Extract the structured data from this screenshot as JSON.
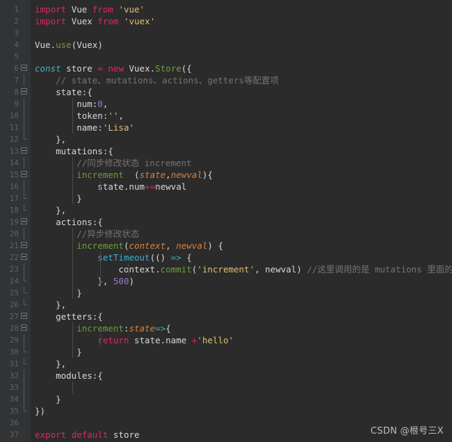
{
  "editor": {
    "theme": "darcula",
    "background": "#2b2b2b",
    "gutter_background": "#313335",
    "line_number_color": "#606366",
    "default_text_color": "#a9b7c6",
    "colors": {
      "keyword": "#e2265f",
      "string": "#e5bf6e",
      "number": "#9876dd",
      "comment": "#737570",
      "function": "#6a9f3e",
      "builtin": "#3eb0c7",
      "parameter": "#d9803d",
      "operator": "#e2265f",
      "plain": "#d8d8d8"
    },
    "total_lines": 37,
    "language": "javascript",
    "filename_hint": "store.js"
  },
  "watermark": {
    "text": "CSDN @根号三X"
  },
  "lines": [
    {
      "n": 1,
      "fold": "none",
      "guides": [],
      "tokens": [
        {
          "t": "import",
          "c": "imp"
        },
        {
          "t": " ",
          "c": "plain"
        },
        {
          "t": "Vue",
          "c": "plain"
        },
        {
          "t": " ",
          "c": "plain"
        },
        {
          "t": "from",
          "c": "imp"
        },
        {
          "t": " ",
          "c": "plain"
        },
        {
          "t": "'vue'",
          "c": "str"
        }
      ]
    },
    {
      "n": 2,
      "fold": "none",
      "guides": [],
      "tokens": [
        {
          "t": "import",
          "c": "imp"
        },
        {
          "t": " ",
          "c": "plain"
        },
        {
          "t": "Vuex",
          "c": "plain"
        },
        {
          "t": " ",
          "c": "plain"
        },
        {
          "t": "from",
          "c": "imp"
        },
        {
          "t": " ",
          "c": "plain"
        },
        {
          "t": "'vuex'",
          "c": "str"
        }
      ]
    },
    {
      "n": 3,
      "fold": "none",
      "guides": [],
      "tokens": []
    },
    {
      "n": 4,
      "fold": "none",
      "guides": [],
      "tokens": [
        {
          "t": "Vue",
          "c": "plain"
        },
        {
          "t": ".",
          "c": "plain"
        },
        {
          "t": "use",
          "c": "fn"
        },
        {
          "t": "(Vuex)",
          "c": "plain"
        }
      ]
    },
    {
      "n": 5,
      "fold": "none",
      "guides": [],
      "tokens": []
    },
    {
      "n": 6,
      "fold": "box",
      "guides": [],
      "tokens": [
        {
          "t": "const",
          "c": "italic"
        },
        {
          "t": " store ",
          "c": "plain"
        },
        {
          "t": "=",
          "c": "op"
        },
        {
          "t": " ",
          "c": "plain"
        },
        {
          "t": "new",
          "c": "imp"
        },
        {
          "t": " Vuex.",
          "c": "plain"
        },
        {
          "t": "Store",
          "c": "fn"
        },
        {
          "t": "({",
          "c": "plain"
        }
      ]
    },
    {
      "n": 7,
      "fold": "line",
      "guides": [],
      "tokens": [
        {
          "t": "    // state、mutations、actions、getters等配置项",
          "c": "com"
        }
      ]
    },
    {
      "n": 8,
      "fold": "box",
      "guides": [],
      "tokens": [
        {
          "t": "    state:{",
          "c": "plain"
        }
      ]
    },
    {
      "n": 9,
      "fold": "line",
      "guides": [
        60
      ],
      "tokens": [
        {
          "t": "        num:",
          "c": "plain"
        },
        {
          "t": "0",
          "c": "num"
        },
        {
          "t": ",",
          "c": "plain"
        }
      ]
    },
    {
      "n": 10,
      "fold": "line",
      "guides": [
        60
      ],
      "tokens": [
        {
          "t": "        token:",
          "c": "plain"
        },
        {
          "t": "''",
          "c": "str"
        },
        {
          "t": ",",
          "c": "plain"
        }
      ]
    },
    {
      "n": 11,
      "fold": "line",
      "guides": [
        60
      ],
      "tokens": [
        {
          "t": "        name:",
          "c": "plain"
        },
        {
          "t": "'Lisa'",
          "c": "str"
        }
      ]
    },
    {
      "n": 12,
      "fold": "end",
      "guides": [],
      "tokens": [
        {
          "t": "    },",
          "c": "plain"
        }
      ]
    },
    {
      "n": 13,
      "fold": "box",
      "guides": [],
      "tokens": [
        {
          "t": "    mutations:{",
          "c": "plain"
        }
      ]
    },
    {
      "n": 14,
      "fold": "line",
      "guides": [
        60
      ],
      "tokens": [
        {
          "t": "        //同步修改状态 increment",
          "c": "com"
        }
      ]
    },
    {
      "n": 15,
      "fold": "box",
      "guides": [
        60
      ],
      "tokens": [
        {
          "t": "        ",
          "c": "plain"
        },
        {
          "t": "increment",
          "c": "fn"
        },
        {
          "t": "  (",
          "c": "plain"
        },
        {
          "t": "state",
          "c": "param"
        },
        {
          "t": ",",
          "c": "plain"
        },
        {
          "t": "newval",
          "c": "param"
        },
        {
          "t": "){",
          "c": "plain"
        }
      ]
    },
    {
      "n": 16,
      "fold": "line",
      "guides": [
        60,
        100
      ],
      "tokens": [
        {
          "t": "            state.num",
          "c": "plain"
        },
        {
          "t": "+=",
          "c": "op"
        },
        {
          "t": "newval",
          "c": "plain"
        }
      ]
    },
    {
      "n": 17,
      "fold": "end",
      "guides": [
        60
      ],
      "tokens": [
        {
          "t": "        }",
          "c": "plain"
        }
      ]
    },
    {
      "n": 18,
      "fold": "end",
      "guides": [],
      "tokens": [
        {
          "t": "    },",
          "c": "plain"
        }
      ]
    },
    {
      "n": 19,
      "fold": "box",
      "guides": [],
      "tokens": [
        {
          "t": "    actions:{",
          "c": "plain"
        }
      ]
    },
    {
      "n": 20,
      "fold": "line",
      "guides": [
        60
      ],
      "tokens": [
        {
          "t": "        //异步修改状态",
          "c": "com"
        }
      ]
    },
    {
      "n": 21,
      "fold": "box",
      "guides": [
        60
      ],
      "tokens": [
        {
          "t": "        ",
          "c": "plain"
        },
        {
          "t": "increment",
          "c": "fn"
        },
        {
          "t": "(",
          "c": "plain"
        },
        {
          "t": "context",
          "c": "param"
        },
        {
          "t": ", ",
          "c": "plain"
        },
        {
          "t": "newval",
          "c": "param"
        },
        {
          "t": ") {",
          "c": "plain"
        }
      ]
    },
    {
      "n": 22,
      "fold": "box",
      "guides": [
        60,
        100
      ],
      "tokens": [
        {
          "t": "            ",
          "c": "plain"
        },
        {
          "t": "setTimeout",
          "c": "builtin"
        },
        {
          "t": "(() ",
          "c": "plain"
        },
        {
          "t": "=>",
          "c": "builtin"
        },
        {
          "t": " {",
          "c": "plain"
        }
      ]
    },
    {
      "n": 23,
      "fold": "line",
      "guides": [
        60,
        100,
        140
      ],
      "tokens": [
        {
          "t": "                context.",
          "c": "plain"
        },
        {
          "t": "commit",
          "c": "fn"
        },
        {
          "t": "(",
          "c": "plain"
        },
        {
          "t": "'increment'",
          "c": "str"
        },
        {
          "t": ", newval) ",
          "c": "plain"
        },
        {
          "t": "//这里调用的是 mutations 里面的方法",
          "c": "com"
        }
      ]
    },
    {
      "n": 24,
      "fold": "end",
      "guides": [
        60,
        100
      ],
      "tokens": [
        {
          "t": "            }, ",
          "c": "plain"
        },
        {
          "t": "500",
          "c": "num"
        },
        {
          "t": ")",
          "c": "plain"
        }
      ]
    },
    {
      "n": 25,
      "fold": "end",
      "guides": [
        60
      ],
      "tokens": [
        {
          "t": "        }",
          "c": "plain"
        }
      ]
    },
    {
      "n": 26,
      "fold": "end",
      "guides": [],
      "tokens": [
        {
          "t": "    },",
          "c": "plain"
        }
      ]
    },
    {
      "n": 27,
      "fold": "box",
      "guides": [],
      "tokens": [
        {
          "t": "    getters:{",
          "c": "plain"
        }
      ]
    },
    {
      "n": 28,
      "fold": "box",
      "guides": [
        60
      ],
      "tokens": [
        {
          "t": "        ",
          "c": "plain"
        },
        {
          "t": "increment",
          "c": "fn"
        },
        {
          "t": ":",
          "c": "plain"
        },
        {
          "t": "state",
          "c": "param"
        },
        {
          "t": "=>",
          "c": "builtin"
        },
        {
          "t": "{",
          "c": "plain"
        }
      ]
    },
    {
      "n": 29,
      "fold": "line",
      "guides": [
        60,
        100
      ],
      "tokens": [
        {
          "t": "            ",
          "c": "plain"
        },
        {
          "t": "return",
          "c": "imp"
        },
        {
          "t": " state.name ",
          "c": "plain"
        },
        {
          "t": "+",
          "c": "op"
        },
        {
          "t": "'hello'",
          "c": "str"
        }
      ]
    },
    {
      "n": 30,
      "fold": "end",
      "guides": [
        60
      ],
      "tokens": [
        {
          "t": "        }",
          "c": "plain"
        }
      ]
    },
    {
      "n": 31,
      "fold": "end",
      "guides": [],
      "tokens": [
        {
          "t": "    },",
          "c": "plain"
        }
      ]
    },
    {
      "n": 32,
      "fold": "line",
      "guides": [],
      "tokens": [
        {
          "t": "    modules:{",
          "c": "plain"
        }
      ]
    },
    {
      "n": 33,
      "fold": "line",
      "guides": [
        60
      ],
      "tokens": []
    },
    {
      "n": 34,
      "fold": "line",
      "guides": [],
      "tokens": [
        {
          "t": "    }",
          "c": "plain"
        }
      ]
    },
    {
      "n": 35,
      "fold": "end",
      "guides": [],
      "tokens": [
        {
          "t": "})",
          "c": "plain"
        }
      ]
    },
    {
      "n": 36,
      "fold": "none",
      "guides": [],
      "tokens": []
    },
    {
      "n": 37,
      "fold": "none",
      "guides": [],
      "tokens": [
        {
          "t": "export",
          "c": "imp"
        },
        {
          "t": " ",
          "c": "plain"
        },
        {
          "t": "default",
          "c": "imp"
        },
        {
          "t": " store",
          "c": "plain"
        }
      ]
    }
  ]
}
